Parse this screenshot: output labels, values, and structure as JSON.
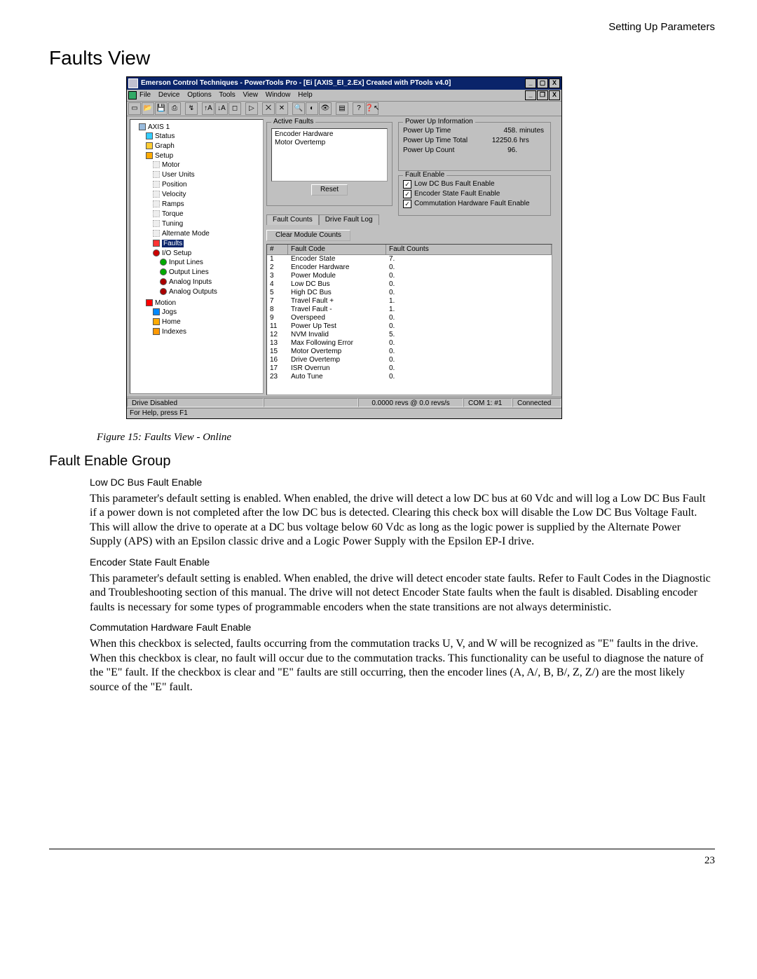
{
  "page": {
    "header": "Setting Up Parameters",
    "h1": "Faults View",
    "figure_caption": "Figure 15:      Faults View - Online",
    "h2": "Fault Enable Group",
    "page_number": "23"
  },
  "sections": {
    "lowdc": {
      "title": "Low DC Bus Fault Enable",
      "body": "This parameter's default setting is enabled. When enabled, the drive will detect a low DC bus at 60 Vdc and will log a Low DC Bus Fault if a power down is not completed after the low DC bus is detected. Clearing this check box will disable the Low DC Bus Voltage Fault. This will allow the drive to operate at a DC bus voltage below 60 Vdc as long as the logic power is supplied by the Alternate Power Supply (APS) with an Epsilon classic drive and a Logic Power Supply with the Epsilon EP-I drive."
    },
    "encoder": {
      "title": "Encoder State Fault Enable",
      "body": "This parameter's default setting is enabled. When enabled, the drive will detect encoder state faults. Refer to Fault Codes in the Diagnostic and Troubleshooting section of this manual. The drive will not detect Encoder State faults when the fault is disabled. Disabling encoder faults is necessary for some types of programmable encoders when the state transitions are not always deterministic."
    },
    "comm": {
      "title": "Commutation Hardware Fault Enable",
      "body": "When this checkbox is selected, faults occurring from the commutation tracks U, V, and W will be recognized as \"E\" faults in the drive. When this checkbox is clear, no fault will occur due to the commutation tracks. This functionality can be useful to diagnose the nature of the \"E\" fault. If the checkbox is clear and \"E\" faults are still occurring, then the encoder lines (A, A/, B, B/, Z, Z/) are the most likely source of the \"E\" fault."
    }
  },
  "app": {
    "title": "Emerson Control Techniques - PowerTools Pro - [Ei  [AXIS_EI_2.Ex] Created with PTools v4.0]",
    "menu": [
      "File",
      "Device",
      "Options",
      "Tools",
      "View",
      "Window",
      "Help"
    ],
    "toolbar_icons": [
      "new",
      "open",
      "save",
      "print",
      "|",
      "reconnect",
      "upload",
      "download",
      "stop",
      "|",
      "run",
      "|",
      "disconnect",
      "delete",
      "|",
      "zoom-in",
      "view",
      "eye",
      "|",
      "chart",
      "|",
      "help",
      "whats-this"
    ],
    "tree": {
      "root": "AXIS 1",
      "items": [
        "Status",
        "Graph",
        "Setup"
      ],
      "setup_children": [
        "Motor",
        "User Units",
        "Position",
        "Velocity",
        "Ramps",
        "Torque",
        "Tuning",
        "Alternate Mode",
        "Faults",
        "I/O Setup"
      ],
      "io_children": [
        "Input Lines",
        "Output Lines",
        "Analog Inputs",
        "Analog Outputs"
      ],
      "motion": "Motion",
      "motion_children": [
        "Jogs",
        "Home",
        "Indexes"
      ]
    },
    "active_faults": {
      "legend": "Active Faults",
      "faults": [
        "Encoder Hardware",
        "Motor Overtemp"
      ],
      "reset": "Reset"
    },
    "power": {
      "legend": "Power Up Information",
      "rows": [
        {
          "label": "Power Up Time",
          "value": "458.",
          "unit": "minutes"
        },
        {
          "label": "Power Up Time Total",
          "value": "12250.6",
          "unit": "hrs"
        },
        {
          "label": "Power Up Count",
          "value": "96.",
          "unit": ""
        }
      ]
    },
    "fault_enable": {
      "legend": "Fault Enable",
      "items": [
        "Low DC Bus Fault Enable",
        "Encoder State Fault Enable",
        "Commutation Hardware Fault Enable"
      ]
    },
    "tabs": {
      "t1": "Fault Counts",
      "t2": "Drive Fault Log"
    },
    "clear_btn": "Clear Module Counts",
    "table": {
      "headers": {
        "n": "#",
        "c": "Fault Code",
        "f": "Fault Counts"
      },
      "rows": [
        {
          "n": "1",
          "c": "Encoder State",
          "f": "7."
        },
        {
          "n": "2",
          "c": "Encoder Hardware",
          "f": "0."
        },
        {
          "n": "3",
          "c": "Power Module",
          "f": "0."
        },
        {
          "n": "4",
          "c": "Low DC Bus",
          "f": "0."
        },
        {
          "n": "5",
          "c": "High DC Bus",
          "f": "0."
        },
        {
          "n": "7",
          "c": "Travel Fault +",
          "f": "1."
        },
        {
          "n": "8",
          "c": "Travel Fault -",
          "f": "1."
        },
        {
          "n": "9",
          "c": "Overspeed",
          "f": "0."
        },
        {
          "n": "11",
          "c": "Power Up Test",
          "f": "0."
        },
        {
          "n": "12",
          "c": "NVM Invalid",
          "f": "5."
        },
        {
          "n": "13",
          "c": "Max Following Error",
          "f": "0."
        },
        {
          "n": "15",
          "c": "Motor Overtemp",
          "f": "0."
        },
        {
          "n": "16",
          "c": "Drive Overtemp",
          "f": "0."
        },
        {
          "n": "17",
          "c": "ISR Overrun",
          "f": "0."
        },
        {
          "n": "23",
          "c": "Auto Tune",
          "f": "0."
        }
      ]
    },
    "status": {
      "drive": "Drive Disabled",
      "pos": "0.0000 revs @ 0.0 revs/s",
      "com": "COM 1: #1",
      "conn": "Connected"
    },
    "help": "For Help, press F1"
  }
}
